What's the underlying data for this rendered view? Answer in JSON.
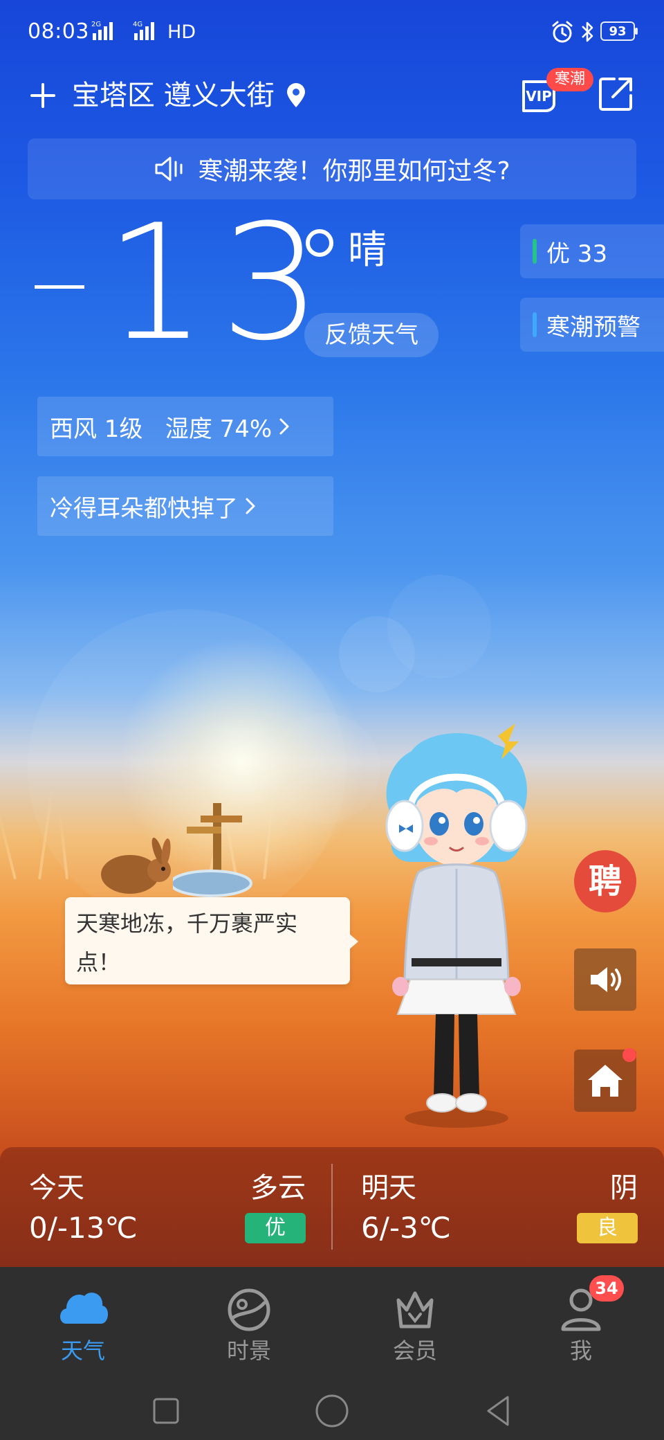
{
  "status_bar": {
    "time": "08:03",
    "network_label": "HD",
    "battery": "93"
  },
  "header": {
    "location": "宝塔区 遵义大街",
    "vip_label": "VIP",
    "vip_badge": "寒潮"
  },
  "notice": {
    "text": "寒潮来袭！你那里如何过冬?"
  },
  "current": {
    "temperature": "13",
    "condition": "晴",
    "feedback_label": "反馈天气",
    "aqi_tag": "优 33",
    "warning_tag": "寒潮预警",
    "wind_humidity": "西风 1级   湿度 74%",
    "joke": "冷得耳朵都快掉了"
  },
  "speech_bubble": {
    "text": "天寒地冻，千万裹严实点！"
  },
  "side_buttons": {
    "recruit": "聘"
  },
  "forecast": {
    "today": {
      "name": "今天",
      "condition": "多云",
      "range": "0/-13℃",
      "aqi": "优",
      "aqi_color": "#26b37a"
    },
    "tomorrow": {
      "name": "明天",
      "condition": "阴",
      "range": "6/-3℃",
      "aqi": "良",
      "aqi_color": "#f0c33c"
    }
  },
  "tabs": [
    {
      "label": "天气",
      "icon": "weather-cloud-icon",
      "active": true
    },
    {
      "label": "时景",
      "icon": "scene-icon",
      "active": false
    },
    {
      "label": "会员",
      "icon": "member-crown-icon",
      "active": false
    },
    {
      "label": "我",
      "icon": "profile-icon",
      "active": false,
      "badge": "34"
    }
  ],
  "colors": {
    "aqi_indicator": "#25c28a",
    "warning_indicator": "#3fa9ff",
    "tab_active": "#3b9bf0",
    "tab_inactive": "#999999",
    "badge_red": "#ff4e4e"
  }
}
